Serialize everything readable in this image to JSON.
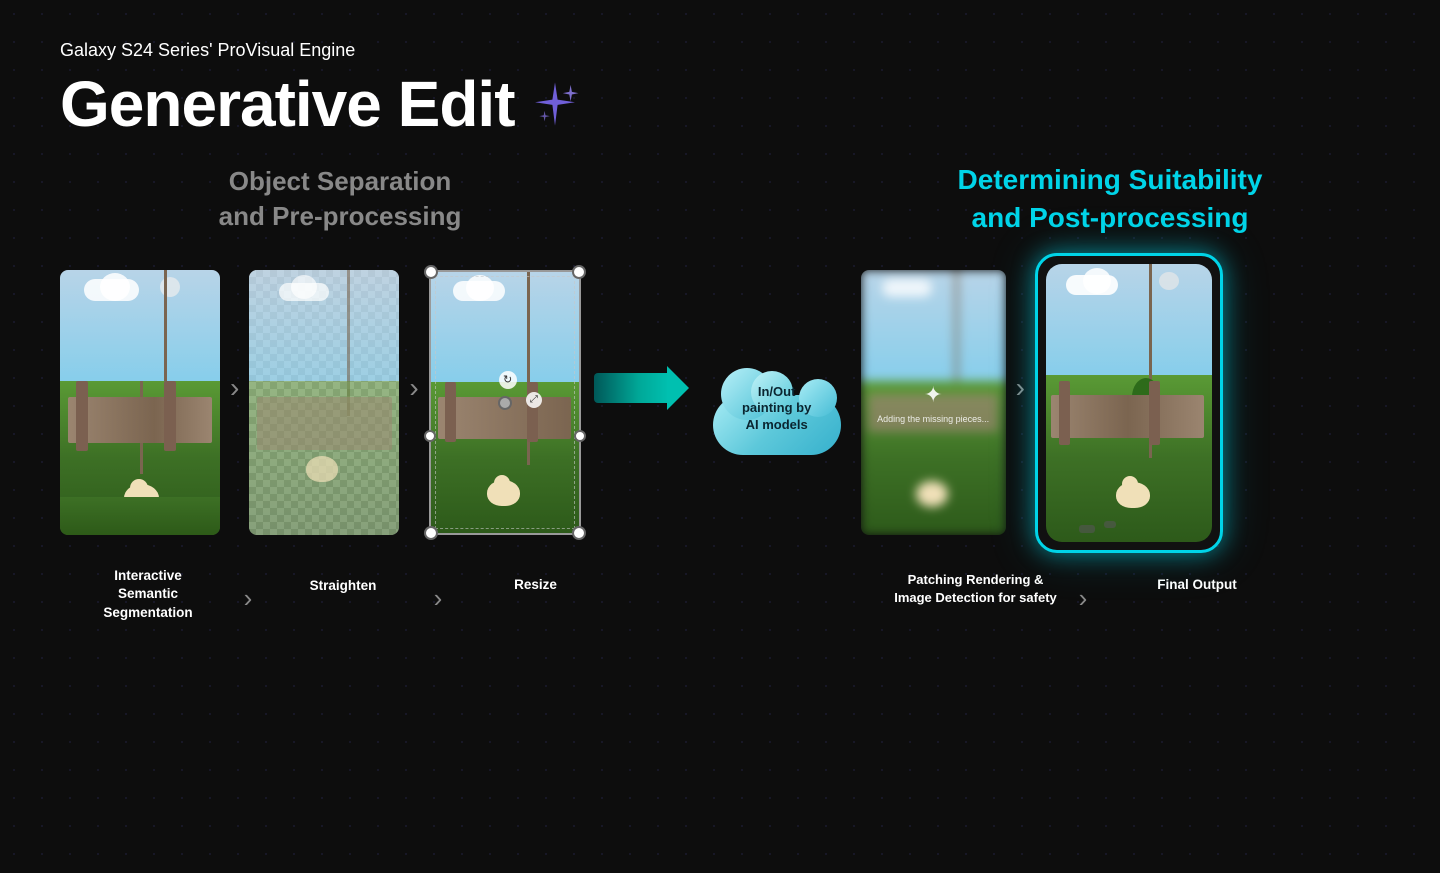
{
  "header": {
    "subtitle": "Galaxy S24 Series' ProVisual Engine",
    "title": "Generative Edit"
  },
  "sections": {
    "left_label_line1": "Object Separation",
    "left_label_line2": "and Pre-processing",
    "right_label_line1": "Determining Suitability",
    "right_label_line2": "and Post-processing"
  },
  "cloud": {
    "line1": "In/Out",
    "line2": "painting by",
    "line3": "AI models"
  },
  "adding_text": "Adding the missing pieces...",
  "labels": {
    "step1_line1": "Interactive",
    "step1_line2": "Semantic",
    "step1_line3": "Segmentation",
    "step2": "Straighten",
    "step3": "Resize",
    "step4_line1": "Patching Rendering &",
    "step4_line2": "Image Detection for safety",
    "step5": "Final Output"
  },
  "colors": {
    "background": "#0d0d0d",
    "title_white": "#ffffff",
    "section_gray": "#888888",
    "section_cyan": "#00d4e8",
    "arrow_gray": "#888888",
    "phone_border": "#00d4e8"
  }
}
